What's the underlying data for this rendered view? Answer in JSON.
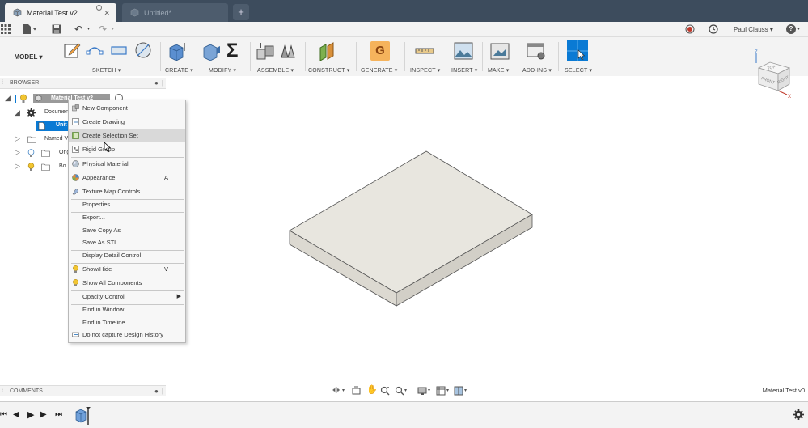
{
  "tabs": [
    {
      "label": "Material Test v2",
      "active": true
    },
    {
      "label": "Untitled*",
      "active": false
    }
  ],
  "new_tab_label": "+",
  "quick_access": {
    "user_name": "Paul Clauss",
    "help_label": "?"
  },
  "ribbon": {
    "workspace": "MODEL",
    "groups": [
      {
        "label": "SKETCH ▾"
      },
      {
        "label": "CREATE ▾"
      },
      {
        "label": "MODIFY ▾"
      },
      {
        "label": "ASSEMBLE ▾"
      },
      {
        "label": "CONSTRUCT ▾"
      },
      {
        "label": "GENERATE ▾"
      },
      {
        "label": "INSPECT ▾"
      },
      {
        "label": "INSERT ▾"
      },
      {
        "label": "MAKE ▾"
      },
      {
        "label": "ADD-INS ▾"
      },
      {
        "label": "SELECT ▾"
      }
    ]
  },
  "viewcube": {
    "top": "TOP",
    "front": "FRONT",
    "right": "RIGHT",
    "axis_x": "X",
    "axis_z": "Z"
  },
  "browser": {
    "title": "BROWSER",
    "root": "Material Test v2",
    "items": [
      {
        "label": "Documen"
      },
      {
        "label": "Unit"
      },
      {
        "label": "Named V"
      },
      {
        "label": "Origi"
      },
      {
        "label": "Bo"
      }
    ]
  },
  "context_menu": {
    "items": [
      {
        "label": "New Component",
        "shortcut": "",
        "highlight": false
      },
      {
        "label": "Create Drawing",
        "shortcut": "",
        "highlight": false
      },
      {
        "label": "Create Selection Set",
        "shortcut": "",
        "highlight": true
      },
      {
        "label": "Rigid Group",
        "shortcut": "",
        "highlight": false
      },
      {
        "label": "Physical Material",
        "shortcut": "",
        "highlight": false
      },
      {
        "label": "Appearance",
        "shortcut": "A",
        "highlight": false
      },
      {
        "label": "Texture Map Controls",
        "shortcut": "",
        "highlight": false
      },
      {
        "label": "Properties",
        "shortcut": "",
        "highlight": false
      },
      {
        "label": "Export...",
        "shortcut": "",
        "highlight": false
      },
      {
        "label": "Save Copy As",
        "shortcut": "",
        "highlight": false
      },
      {
        "label": "Save As STL",
        "shortcut": "",
        "highlight": false
      },
      {
        "label": "Display Detail Control",
        "shortcut": "",
        "highlight": false
      },
      {
        "label": "Show/Hide",
        "shortcut": "V",
        "highlight": false
      },
      {
        "label": "Show All Components",
        "shortcut": "",
        "highlight": false
      },
      {
        "label": "Opacity Control",
        "shortcut": "",
        "highlight": false
      },
      {
        "label": "Find in Window",
        "shortcut": "",
        "highlight": false
      },
      {
        "label": "Find in Timeline",
        "shortcut": "",
        "highlight": false
      },
      {
        "label": "Do not capture Design History",
        "shortcut": "",
        "highlight": false
      }
    ]
  },
  "comments": {
    "title": "COMMENTS"
  },
  "document_title": "Material Test v0",
  "colors": {
    "tab_bar": "#3d4c5d",
    "toolbar": "#f3f3f3",
    "selection": "#0a7ad4",
    "menu_highlight": "#d9d9d9"
  }
}
